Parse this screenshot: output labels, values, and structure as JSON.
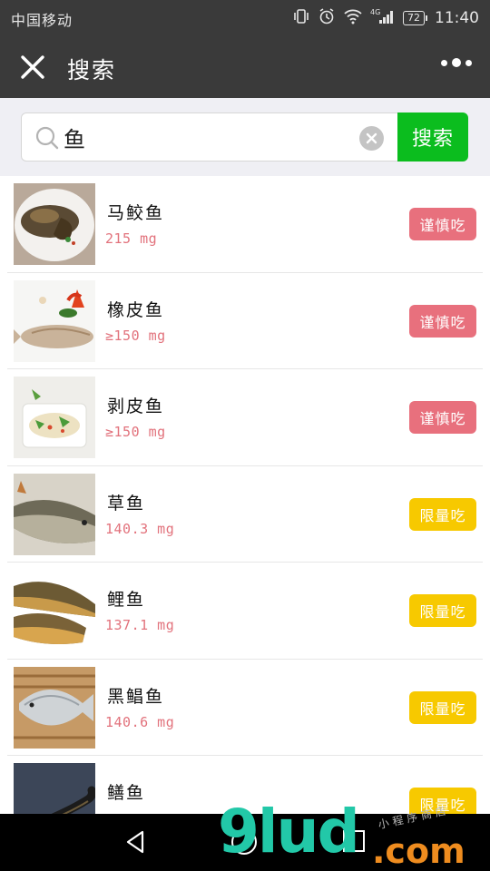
{
  "status_bar": {
    "carrier": "中国移动",
    "battery": "72",
    "network": "4G",
    "time": "11:40",
    "icons": [
      "vibrate-icon",
      "alarm-icon",
      "wifi-icon",
      "signal-icon",
      "battery-icon"
    ]
  },
  "nav": {
    "title": "搜索",
    "close_icon": "close-icon",
    "more_icon": "more-icon"
  },
  "search": {
    "value": "鱼",
    "placeholder": "",
    "button_label": "搜索",
    "icon": "search-icon",
    "clear_icon": "clear-icon"
  },
  "colors": {
    "caution": "#e8707d",
    "limit": "#f7c900",
    "accent": "#0bbd1e"
  },
  "items": [
    {
      "name": "马鲛鱼",
      "value": "215 mg",
      "badge": "谨慎吃",
      "badge_type": "caution"
    },
    {
      "name": "橡皮鱼",
      "value": "≥150 mg",
      "badge": "谨慎吃",
      "badge_type": "caution"
    },
    {
      "name": "剥皮鱼",
      "value": "≥150 mg",
      "badge": "谨慎吃",
      "badge_type": "caution"
    },
    {
      "name": "草鱼",
      "value": "140.3 mg",
      "badge": "限量吃",
      "badge_type": "limit"
    },
    {
      "name": "鲤鱼",
      "value": "137.1 mg",
      "badge": "限量吃",
      "badge_type": "limit"
    },
    {
      "name": "黑鲳鱼",
      "value": "140.6 mg",
      "badge": "限量吃",
      "badge_type": "limit"
    },
    {
      "name": "鳝鱼",
      "value": "",
      "badge": "限量吃",
      "badge_type": "limit"
    }
  ],
  "watermark": {
    "big": "9lud",
    "com": ".com",
    "small": "小程序商店"
  }
}
